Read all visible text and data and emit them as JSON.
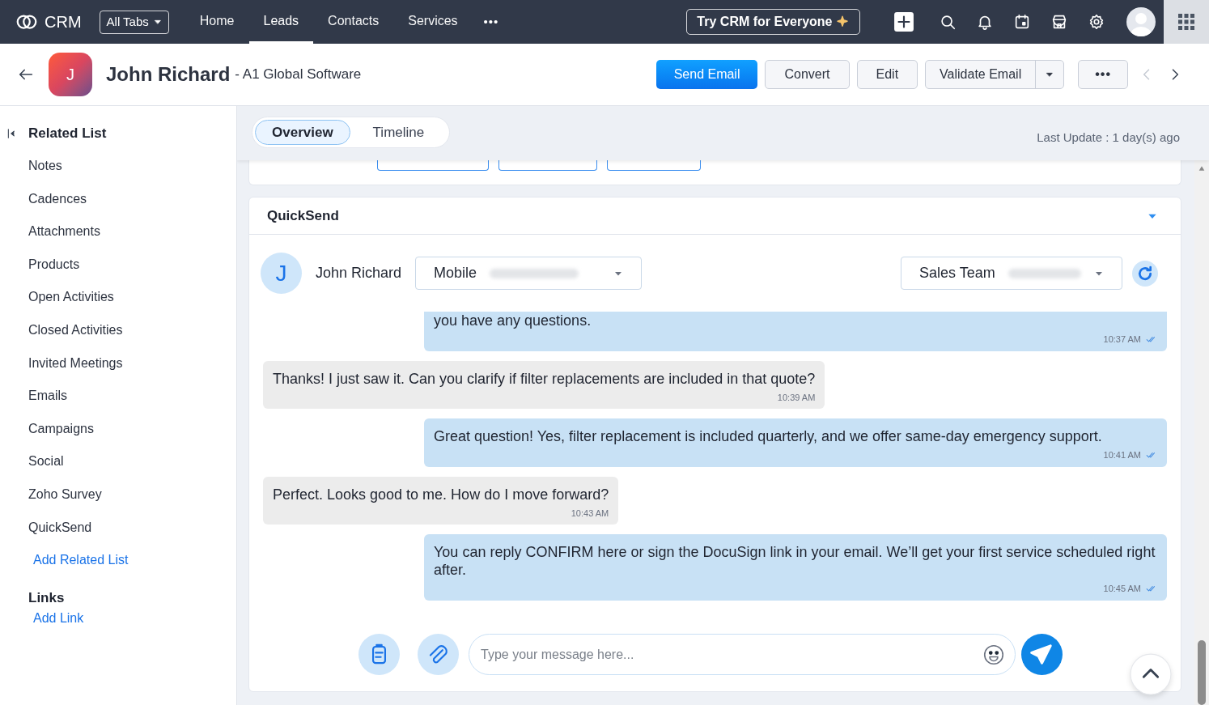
{
  "app": {
    "name": "CRM",
    "all_tabs": "All Tabs",
    "more": "•••",
    "promo": "Try CRM for Everyone"
  },
  "nav_tabs": [
    {
      "label": "Home",
      "selected": false
    },
    {
      "label": "Leads",
      "selected": true
    },
    {
      "label": "Contacts",
      "selected": false
    },
    {
      "label": "Services",
      "selected": false
    }
  ],
  "record": {
    "initial": "J",
    "name": "John Richard",
    "company": "- A1 Global Software"
  },
  "actions": {
    "primary": "Send Email",
    "buttons": [
      "Convert",
      "Edit"
    ],
    "split": "Validate Email",
    "more": "•••"
  },
  "sidebar": {
    "title": "Related List",
    "items": [
      "Notes",
      "Cadences",
      "Attachments",
      "Products",
      "Open Activities",
      "Closed Activities",
      "Invited Meetings",
      "Emails",
      "Campaigns",
      "Social",
      "Zoho Survey",
      "QuickSend"
    ],
    "add": "Add Related List",
    "links_title": "Links",
    "add_link": "Add Link"
  },
  "view_tabs": [
    {
      "label": "Overview",
      "selected": true
    },
    {
      "label": "Timeline",
      "selected": false
    }
  ],
  "last_update": "Last Update : 1 day(s) ago",
  "quicksend": {
    "title": "QuickSend",
    "contact_initial": "J",
    "contact_name": "John Richard",
    "channel": "Mobile",
    "sender": "Sales Team",
    "messages": [
      {
        "kind": "sent",
        "text": "you have any questions.",
        "time": "10:37 AM"
      },
      {
        "kind": "received",
        "text": "Thanks! I just saw it. Can you clarify if filter replacements are included in that quote?",
        "time": "10:39 AM"
      },
      {
        "kind": "sent",
        "text": "Great question! Yes, filter replacement is included quarterly, and we offer same-day emergency support.",
        "time": "10:41 AM"
      },
      {
        "kind": "received",
        "text": "Perfect. Looks good to me. How do I move forward?",
        "time": "10:43 AM"
      },
      {
        "kind": "sent",
        "text": "You can reply CONFIRM here or sign the DocuSign link in your email. We’ll get your first service scheduled right after.",
        "time": "10:45 AM"
      }
    ],
    "placeholder": "Type your message here..."
  }
}
